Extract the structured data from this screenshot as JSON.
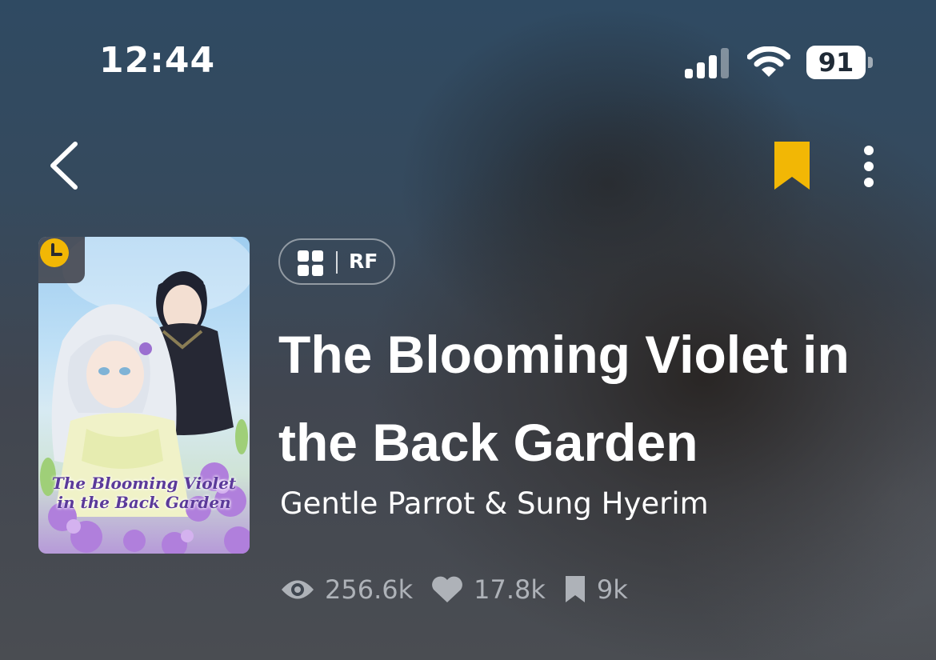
{
  "status_bar": {
    "time": "12:44",
    "battery": "91",
    "icons": [
      "signal-icon",
      "wifi-icon",
      "battery-icon"
    ]
  },
  "nav": {
    "back_icon": "chevron-left-icon",
    "bookmark_icon": "bookmark-icon",
    "more_icon": "more-vertical-icon",
    "bookmark_color": "#f2b705"
  },
  "series": {
    "cover_title_line1": "The Blooming Violet",
    "cover_title_line2": "in the Back Garden",
    "cover_badge_icon": "clock-icon",
    "tag_icon": "grid-icon",
    "tag_label": "RF",
    "title": "The Blooming Violet in the Back Garden",
    "authors": "Gentle Parrot & Sung Hyerim",
    "stats": {
      "views": "256.6k",
      "likes": "17.8k",
      "bookmarks": "9k"
    }
  },
  "colors": {
    "accent": "#f2b705",
    "text": "#ffffff",
    "muted": "#aeb2b8"
  }
}
